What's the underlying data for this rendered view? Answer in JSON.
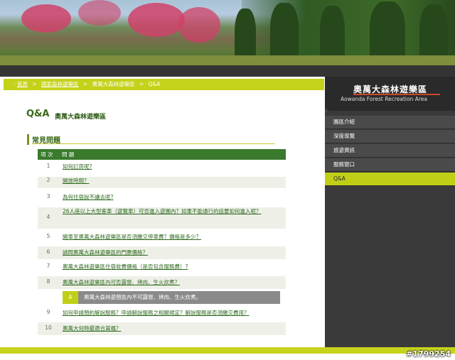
{
  "sidebar": {
    "title": "奧萬大森林遊樂區",
    "subtitle": "Aowanda Forest Recreation Area",
    "dots": "::",
    "items": [
      {
        "label": "園區介紹"
      },
      {
        "label": "深度導覽"
      },
      {
        "label": "旅遊資訊"
      },
      {
        "label": "服務窗口"
      },
      {
        "label": "Q&A"
      }
    ]
  },
  "breadcrumb": {
    "items": [
      "首頁",
      "國家森林遊樂區",
      "奧萬大森林遊樂區",
      "Q&A"
    ],
    "separator": ">"
  },
  "page": {
    "title": "Q&A",
    "subtitle": "奧萬大森林遊樂區",
    "section_title": "常見問題"
  },
  "table": {
    "headers": [
      "項 次",
      "問 題"
    ],
    "rows": [
      {
        "no": "1",
        "q": "如何訂房呢?"
      },
      {
        "no": "2",
        "q": "開放時間？"
      },
      {
        "no": "3",
        "q": "為何住宿說不讓去呢?"
      },
      {
        "no": "4",
        "q": "26人座以上大型客車（遊覽車）可否進入遊園內？如果不能通行的話要如何進入呢？"
      },
      {
        "no": "5",
        "q": "開車至奧萬大森林遊樂區是否須繳交停車費？價格是多少？"
      },
      {
        "no": "6",
        "q": "請問奧萬大森林遊樂區的門票價格？"
      },
      {
        "no": "7",
        "q": "奧萬大森林遊樂區住宿收費價格（是否包含服務費）?"
      },
      {
        "no": "8",
        "q": "奧萬大森林遊樂區內可否露營、烤肉、生火炊煮？"
      },
      {
        "no": "9",
        "q": "如何申請預約解說服務？申請解說服務之相關規定？解說服務是否須繳交費用？"
      },
      {
        "no": "10",
        "q": "奧萬大何時最適合賞楓？"
      }
    ],
    "answer": {
      "tag": "A",
      "text": "奧萬大森林遊憩區內不可露營、烤肉、生火炊煮。"
    }
  },
  "watermark": "#1799254"
}
